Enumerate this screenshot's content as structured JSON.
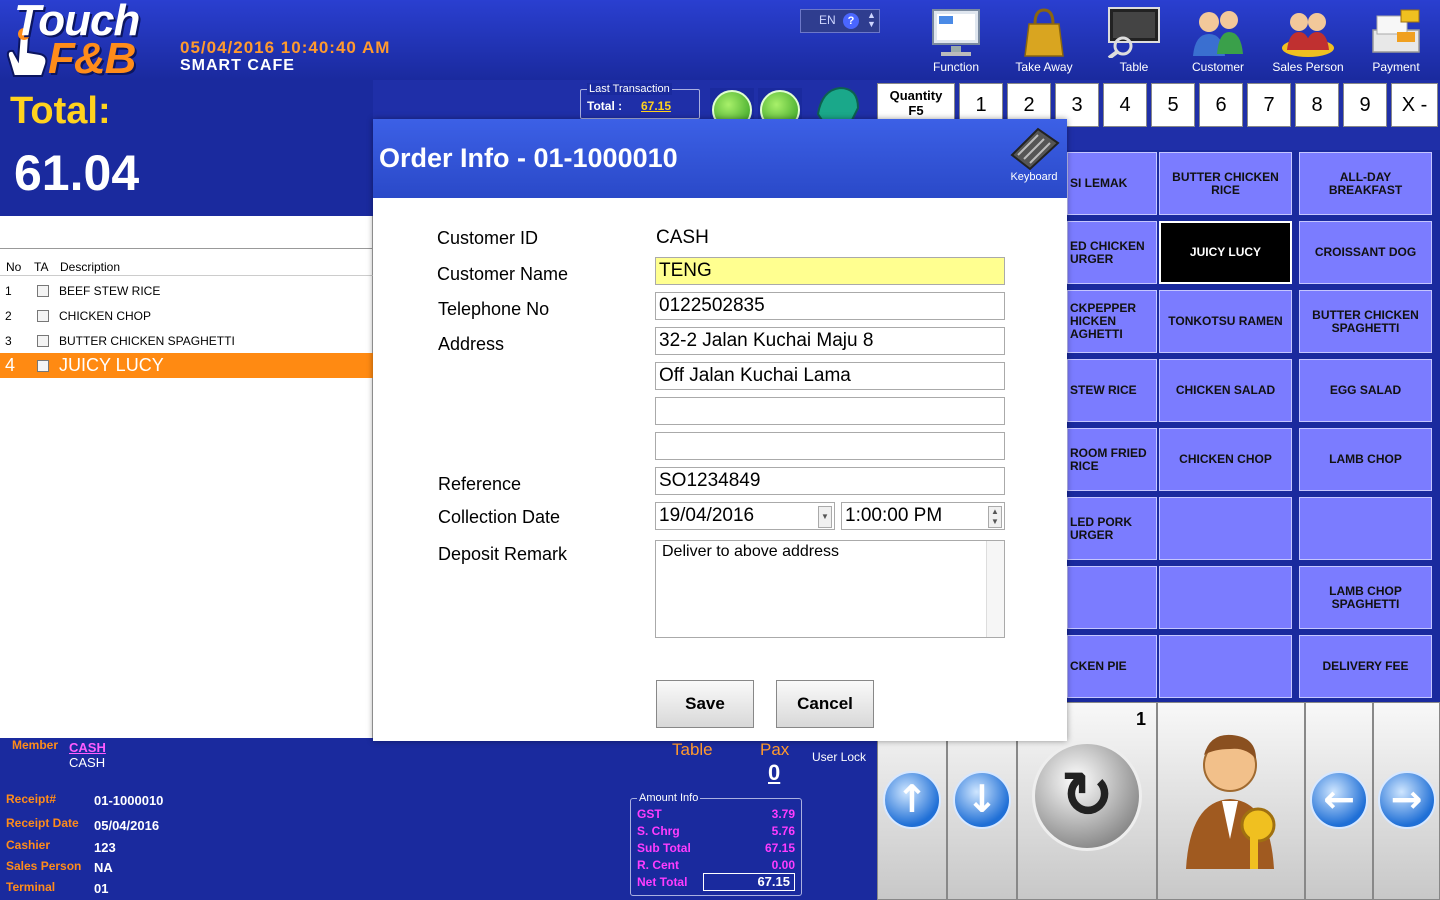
{
  "header": {
    "logo_line1": "Touch",
    "logo_line2": "F&B",
    "datetime": "05/04/2016 10:40:40 AM",
    "shop_name": "SMART CAFE",
    "language": "EN",
    "help": "?"
  },
  "toolbar": [
    {
      "label": "Function",
      "icon": "monitor-icon"
    },
    {
      "label": "Take Away",
      "icon": "shopping-bag-icon"
    },
    {
      "label": "Table",
      "icon": "table-search-icon"
    },
    {
      "label": "Customer",
      "icon": "customers-icon"
    },
    {
      "label": "Sales Person",
      "icon": "sales-person-icon"
    },
    {
      "label": "Payment",
      "icon": "payment-icon"
    }
  ],
  "totals": {
    "label": "Total:",
    "value": "61.04"
  },
  "last_transaction": {
    "caption": "Last Transaction",
    "label": "Total :",
    "value": "67.15"
  },
  "quantity": {
    "label_line1": "Quantity",
    "label_line2": "F5",
    "keys": [
      "1",
      "2",
      "3",
      "4",
      "5",
      "6",
      "7",
      "8",
      "9",
      "X -"
    ]
  },
  "order_list": {
    "headers": {
      "no": "No",
      "ta": "TA",
      "description": "Description"
    },
    "rows": [
      {
        "no": "1",
        "description": "BEEF STEW RICE"
      },
      {
        "no": "2",
        "description": "CHICKEN CHOP"
      },
      {
        "no": "3",
        "description": "BUTTER CHICKEN SPAGHETTI"
      },
      {
        "no": "4",
        "description": "JUICY LUCY"
      }
    ]
  },
  "member": {
    "label": "Member",
    "link": "CASH",
    "value": "CASH"
  },
  "receipt": {
    "receipt_no_label": "Receipt#",
    "receipt_no": "01-1000010",
    "receipt_date_label": "Receipt Date",
    "receipt_date": "05/04/2016",
    "cashier_label": "Cashier",
    "cashier": "123",
    "sales_person_label": "Sales Person",
    "sales_person": "NA",
    "terminal_label": "Terminal",
    "terminal": "01"
  },
  "table_pax": {
    "table_label": "Table",
    "pax_label": "Pax",
    "pax_value": "0",
    "user_lock": "User Lock"
  },
  "amount_info": {
    "caption": "Amount Info",
    "rows": [
      {
        "label": "GST",
        "value": "3.79"
      },
      {
        "label": "S. Chrg",
        "value": "5.76"
      },
      {
        "label": "Sub Total",
        "value": "67.15"
      },
      {
        "label": "R. Cent",
        "value": "0.00"
      }
    ],
    "net_total_label": "Net Total",
    "net_total": "67.15"
  },
  "menu_items": [
    [
      "SI LEMAK",
      "BUTTER CHICKEN RICE",
      "ALL-DAY BREAKFAST"
    ],
    [
      "ED CHICKEN URGER",
      "JUICY LUCY",
      "CROISSANT DOG"
    ],
    [
      "CKPEPPER HICKEN AGHETTI",
      "TONKOTSU RAMEN",
      "BUTTER CHICKEN SPAGHETTI"
    ],
    [
      "STEW RICE",
      "CHICKEN SALAD",
      "EGG SALAD"
    ],
    [
      "ROOM FRIED RICE",
      "CHICKEN CHOP",
      "LAMB CHOP"
    ],
    [
      "LED PORK URGER",
      "",
      ""
    ],
    [
      "",
      "",
      "LAMB CHOP SPAGHETTI"
    ],
    [
      "CKEN PIE",
      "",
      "DELIVERY FEE"
    ]
  ],
  "page_indicator": "1",
  "modal": {
    "title": "Order Info - 01-1000010",
    "keyboard_label": "Keyboard",
    "customer_id_label": "Customer ID",
    "customer_id": "CASH",
    "customer_name_label": "Customer Name",
    "customer_name": "TENG",
    "telephone_label": "Telephone No",
    "telephone": "0122502835",
    "address_label": "Address",
    "address1": "32-2 Jalan Kuchai Maju 8",
    "address2": "Off Jalan Kuchai Lama",
    "address3": "",
    "address4": "",
    "reference_label": "Reference",
    "reference": "SO1234849",
    "collection_date_label": "Collection Date",
    "collection_date": "19/04/2016",
    "collection_time": "1:00:00 PM",
    "deposit_remark_label": "Deposit Remark",
    "deposit_remark": "Deliver to above address",
    "save_label": "Save",
    "cancel_label": "Cancel"
  }
}
